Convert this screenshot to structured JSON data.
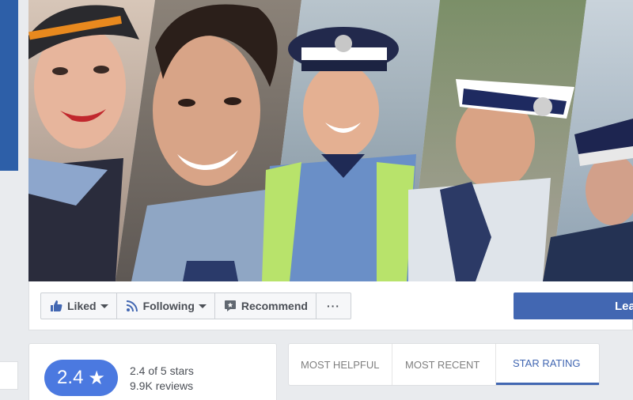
{
  "page_actions": {
    "liked_label": "Liked",
    "following_label": "Following",
    "recommend_label": "Recommend",
    "more_label": "···",
    "primary_cta_label": "Lea"
  },
  "rating_summary": {
    "score": "2.4",
    "star_symbol": "★",
    "stars_text": "2.4 of 5 stars",
    "reviews_text": "9.9K reviews"
  },
  "review_tabs": {
    "tabs": [
      {
        "label": "MOST HELPFUL"
      },
      {
        "label": "MOST RECENT"
      },
      {
        "label": "STAR RATING"
      }
    ],
    "active_index": 2
  },
  "colors": {
    "accent_blue": "#4267b2",
    "rating_pill": "#4b79e0",
    "sidebar_blue": "#2d5fa8"
  },
  "icons": [
    "thumbs-up-icon",
    "rss-icon",
    "speech-bubble-icon",
    "chevron-down-icon",
    "star-icon"
  ]
}
